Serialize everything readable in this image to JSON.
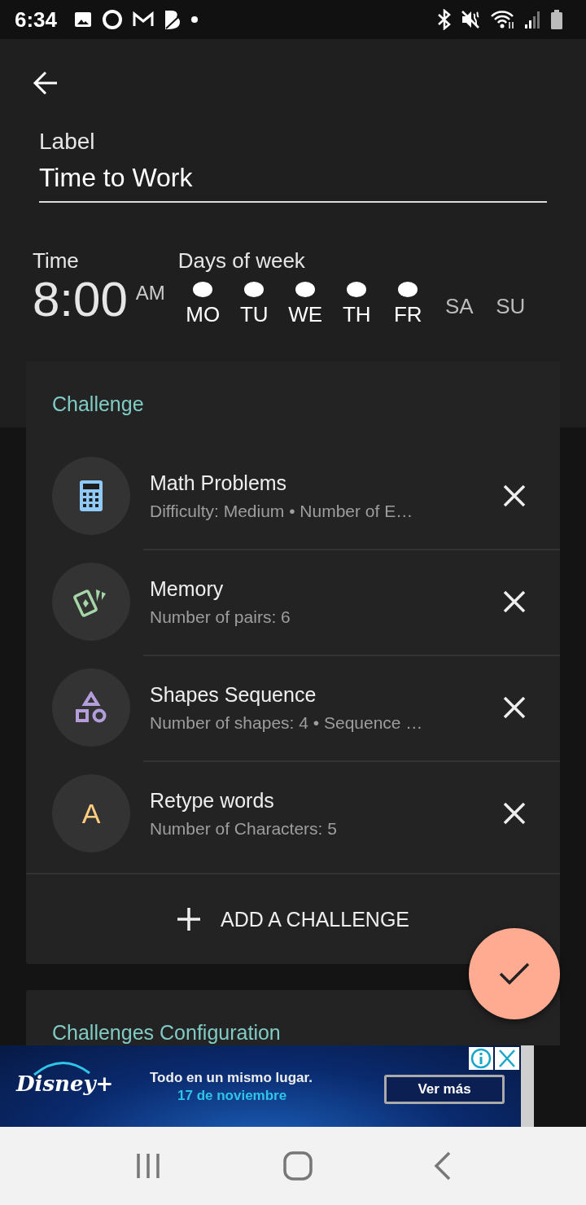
{
  "status_bar": {
    "time": "6:34"
  },
  "label": {
    "caption": "Label",
    "value": "Time to Work"
  },
  "time": {
    "caption": "Time",
    "value": "8:00",
    "period": "AM"
  },
  "days": {
    "caption": "Days of week",
    "items": [
      {
        "label": "MO",
        "selected": true
      },
      {
        "label": "TU",
        "selected": true
      },
      {
        "label": "WE",
        "selected": true
      },
      {
        "label": "TH",
        "selected": true
      },
      {
        "label": "FR",
        "selected": true
      },
      {
        "label": "SA",
        "selected": false
      },
      {
        "label": "SU",
        "selected": false
      }
    ]
  },
  "challenge_card": {
    "title": "Challenge",
    "items": [
      {
        "kind": "calculator",
        "color": "#90caf9",
        "title": "Math Problems",
        "subtitle": "Difficulty: Medium • Number of E…"
      },
      {
        "kind": "cards",
        "color": "#a5d6a7",
        "title": "Memory",
        "subtitle": "Number of pairs: 6"
      },
      {
        "kind": "shapes",
        "color": "#b39ddb",
        "title": "Shapes Sequence",
        "subtitle": "Number of shapes: 4 • Sequence …"
      },
      {
        "kind": "letter",
        "color": "#ffcc80",
        "title": "Retype words",
        "subtitle": "Number of Characters: 5",
        "glyph": "A"
      }
    ],
    "add_button": "ADD A CHALLENGE"
  },
  "config_card": {
    "title": "Challenges Configuration"
  },
  "ad": {
    "brand": "Disney+",
    "headline": "Todo en un mismo lugar.",
    "date": "17 de noviembre",
    "button": "Ver más"
  }
}
